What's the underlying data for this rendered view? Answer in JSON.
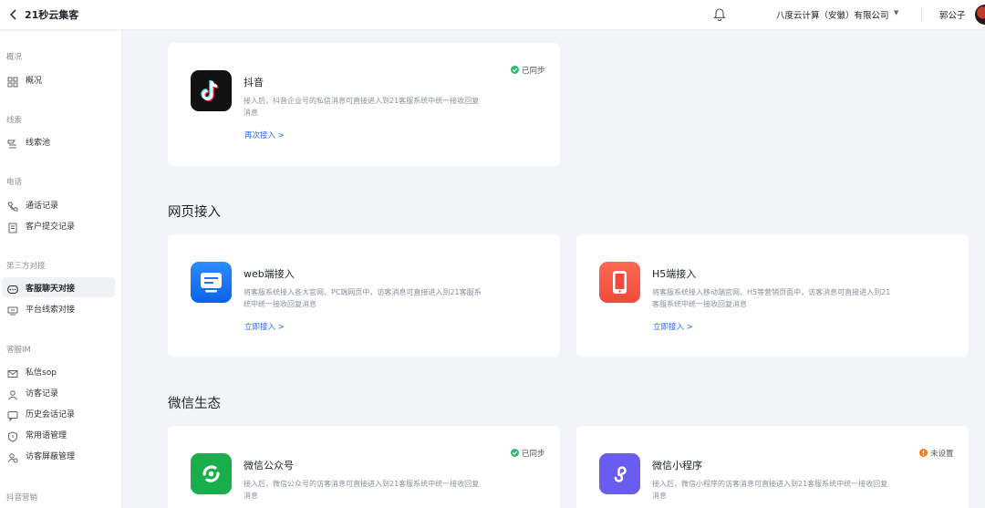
{
  "header": {
    "app_title": "21秒云集客",
    "company": "八度云计算（安徽）有限公司",
    "username": "郭公子"
  },
  "sidebar": {
    "groups": [
      {
        "label": "概况"
      },
      {
        "label": "线索"
      },
      {
        "label": "电话"
      },
      {
        "label": "第三方对接"
      },
      {
        "label": "客服IM"
      },
      {
        "label": "抖音营销"
      }
    ],
    "items": [
      {
        "label": "概况",
        "icon": "grid-icon"
      },
      {
        "label": "线索池",
        "icon": "clue-pool-icon"
      },
      {
        "label": "通话记录",
        "icon": "phone-icon"
      },
      {
        "label": "客户提交记录",
        "icon": "form-icon"
      },
      {
        "label": "客服聊天对接",
        "icon": "chat-icon",
        "active": true
      },
      {
        "label": "平台线索对接",
        "icon": "platform-icon"
      },
      {
        "label": "私信sop",
        "icon": "mail-icon"
      },
      {
        "label": "访客记录",
        "icon": "visitor-icon"
      },
      {
        "label": "历史会话记录",
        "icon": "history-chat-icon"
      },
      {
        "label": "常用语管理",
        "icon": "shield-icon"
      },
      {
        "label": "访客屏蔽管理",
        "icon": "block-user-icon"
      }
    ]
  },
  "sections": {
    "web": "网页接入",
    "wechat": "微信生态"
  },
  "cards": {
    "douyin": {
      "title": "抖音",
      "desc": "接入后，抖音企业号的私信消息可直接进入到21客服系统中统一接收回复消息",
      "link": "再次接入 >",
      "status": "已同步"
    },
    "web": {
      "title": "web端接入",
      "desc": "将客服系统接入各大官网、PC端网页中，访客消息可直接进入到21客服系统中统一接收回复消息",
      "link": "立即接入 >"
    },
    "h5": {
      "title": "H5端接入",
      "desc": "将客服系统接入移动端官网、H5等营销页面中，访客消息可直接进入到21客服系统中统一接收回复消息",
      "link": "立即接入 >"
    },
    "wechat_oa": {
      "title": "微信公众号",
      "desc": "接入后，微信公众号的访客消息可直接进入到21客服系统中统一接收回复消息",
      "status": "已同步"
    },
    "wechat_mini": {
      "title": "微信小程序",
      "desc": "接入后，微信小程序的访客消息可直接进入到21客服系统中统一接收回复消息",
      "status": "未设置"
    }
  },
  "colors": {
    "accent": "#1f6dff",
    "synced": "#2fb873",
    "unset": "#ff7d1f",
    "web_logo": "#1677ff",
    "h5_logo": "#ff5a4a",
    "wechat_logo": "#1aad4b",
    "mini_logo": "#6b5cf0"
  }
}
